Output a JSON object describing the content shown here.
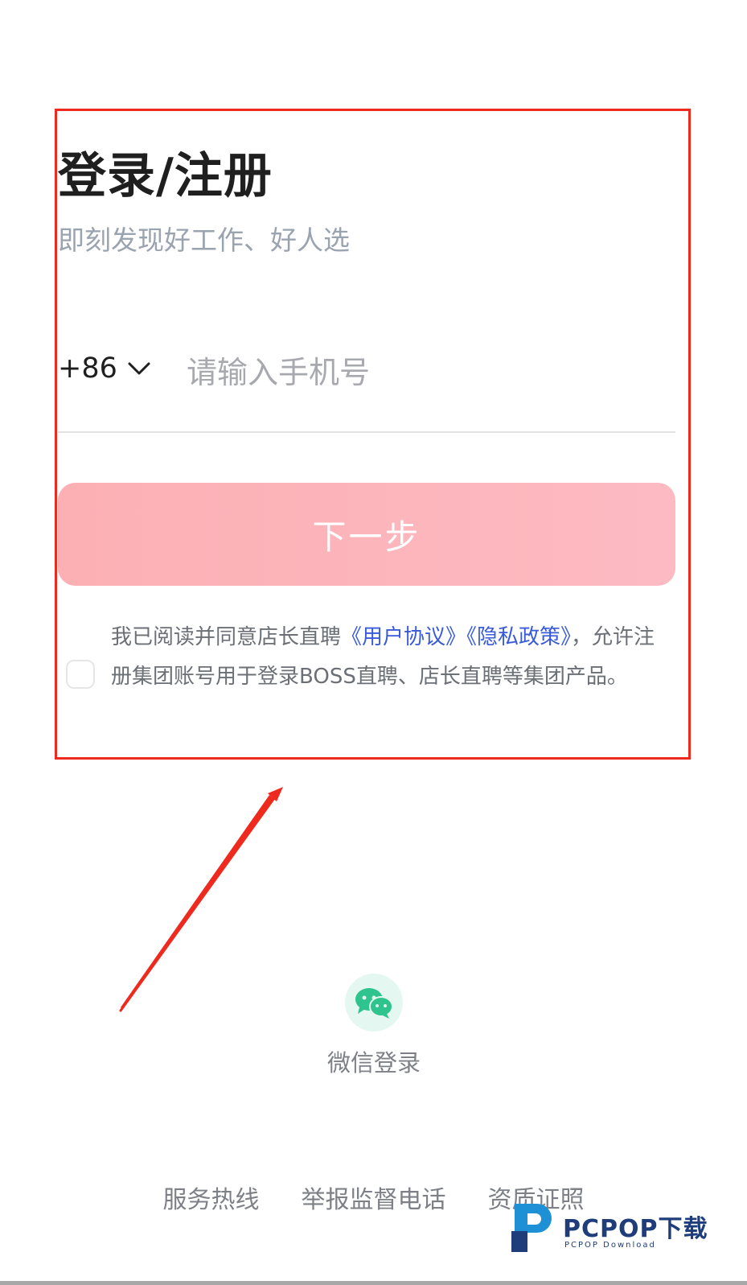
{
  "login": {
    "title": "登录/注册",
    "subtitle": "即刻发现好工作、好人选",
    "country_code": "+86",
    "phone_placeholder": "请输入手机号",
    "phone_value": "",
    "next_button": "下一步",
    "agreement": {
      "checked": false,
      "prefix": "我已阅读并同意店长直聘",
      "user_agreement_link": "《用户协议》",
      "privacy_policy_link": "《隐私政策》",
      "suffix": "，允许注册集团账号用于登录BOSS直聘、店长直聘等集团产品。"
    }
  },
  "wechat_login": {
    "label": "微信登录",
    "icon": "wechat-icon"
  },
  "footer": {
    "links": [
      "服务热线",
      "举报监督电话",
      "资质证照"
    ]
  },
  "watermark": {
    "brand": "PCPOP下载",
    "sub": "PCPOP Download"
  },
  "annotation": {
    "highlight_color": "#ee2a1e"
  },
  "colors": {
    "button_gradient_start": "#fcb0b4",
    "button_gradient_end": "#fdbac2",
    "link": "#3a5bd9",
    "wechat_green": "#2fc48d"
  }
}
